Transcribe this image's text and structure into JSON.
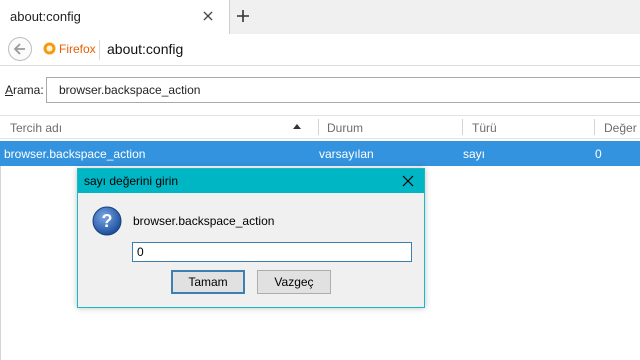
{
  "tab": {
    "title": "about:config"
  },
  "navbar": {
    "identity": "Firefox",
    "url": "about:config"
  },
  "search": {
    "label": "Arama:",
    "value": "browser.backspace_action"
  },
  "table": {
    "columns": [
      "Tercih adı",
      "Durum",
      "Türü",
      "Değer"
    ],
    "rows": [
      {
        "name": "browser.backspace_action",
        "status": "varsayılan",
        "type": "sayı",
        "value": "0"
      }
    ]
  },
  "dialog": {
    "title": "sayı değerini girin",
    "message": "browser.backspace_action",
    "input_value": "0",
    "ok_label": "Tamam",
    "cancel_label": "Vazgeç"
  },
  "colors": {
    "selection": "#3393df",
    "dialog_titlebar": "#00b5c4",
    "firefox_orange": "#e66000"
  },
  "icons": [
    "close-icon",
    "plus-icon",
    "back-arrow-icon",
    "firefox-logo-icon",
    "sort-ascending-icon",
    "question-icon"
  ]
}
